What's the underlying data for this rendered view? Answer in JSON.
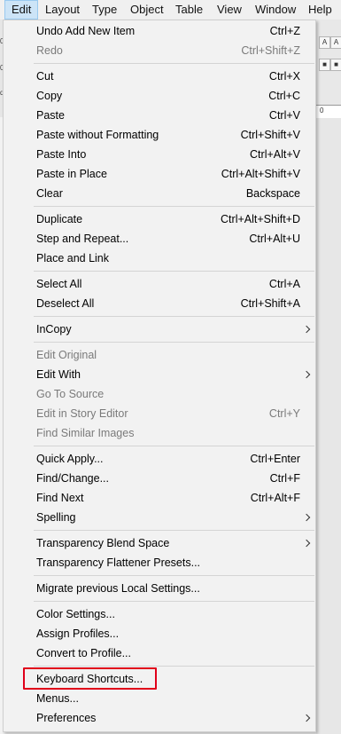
{
  "menubar": {
    "items": [
      "Edit",
      "Layout",
      "Type",
      "Object",
      "Table",
      "View",
      "Window",
      "Help"
    ],
    "active": "Edit"
  },
  "background": {
    "left_fragments": [
      "02",
      "0",
      "d"
    ],
    "ruler_label": "0",
    "controls": [
      "A",
      "A",
      "■",
      "■"
    ]
  },
  "menu": {
    "items": [
      {
        "label": "Undo Add New Item",
        "shortcut": "Ctrl+Z",
        "enabled": true
      },
      {
        "label": "Redo",
        "shortcut": "Ctrl+Shift+Z",
        "enabled": false
      },
      {
        "label": "Cut",
        "shortcut": "Ctrl+X",
        "enabled": true
      },
      {
        "label": "Copy",
        "shortcut": "Ctrl+C",
        "enabled": true
      },
      {
        "label": "Paste",
        "shortcut": "Ctrl+V",
        "enabled": true
      },
      {
        "label": "Paste without Formatting",
        "shortcut": "Ctrl+Shift+V",
        "enabled": true
      },
      {
        "label": "Paste Into",
        "shortcut": "Ctrl+Alt+V",
        "enabled": true
      },
      {
        "label": "Paste in Place",
        "shortcut": "Ctrl+Alt+Shift+V",
        "enabled": true
      },
      {
        "label": "Clear",
        "shortcut": "Backspace",
        "enabled": true
      },
      {
        "label": "Duplicate",
        "shortcut": "Ctrl+Alt+Shift+D",
        "enabled": true
      },
      {
        "label": "Step and Repeat...",
        "shortcut": "Ctrl+Alt+U",
        "enabled": true
      },
      {
        "label": "Place and Link",
        "shortcut": "",
        "enabled": true
      },
      {
        "label": "Select All",
        "shortcut": "Ctrl+A",
        "enabled": true
      },
      {
        "label": "Deselect All",
        "shortcut": "Ctrl+Shift+A",
        "enabled": true
      },
      {
        "label": "InCopy",
        "shortcut": "",
        "enabled": true,
        "submenu": true
      },
      {
        "label": "Edit Original",
        "shortcut": "",
        "enabled": false
      },
      {
        "label": "Edit With",
        "shortcut": "",
        "enabled": true,
        "submenu": true
      },
      {
        "label": "Go To Source",
        "shortcut": "",
        "enabled": false
      },
      {
        "label": "Edit in Story Editor",
        "shortcut": "Ctrl+Y",
        "enabled": false
      },
      {
        "label": "Find Similar Images",
        "shortcut": "",
        "enabled": false
      },
      {
        "label": "Quick Apply...",
        "shortcut": "Ctrl+Enter",
        "enabled": true
      },
      {
        "label": "Find/Change...",
        "shortcut": "Ctrl+F",
        "enabled": true
      },
      {
        "label": "Find Next",
        "shortcut": "Ctrl+Alt+F",
        "enabled": true
      },
      {
        "label": "Spelling",
        "shortcut": "",
        "enabled": true,
        "submenu": true
      },
      {
        "label": "Transparency Blend Space",
        "shortcut": "",
        "enabled": true,
        "submenu": true
      },
      {
        "label": "Transparency Flattener Presets...",
        "shortcut": "",
        "enabled": true
      },
      {
        "label": "Migrate previous Local Settings...",
        "shortcut": "",
        "enabled": true
      },
      {
        "label": "Color Settings...",
        "shortcut": "",
        "enabled": true
      },
      {
        "label": "Assign Profiles...",
        "shortcut": "",
        "enabled": true
      },
      {
        "label": "Convert to Profile...",
        "shortcut": "",
        "enabled": true
      },
      {
        "label": "Keyboard Shortcuts...",
        "shortcut": "",
        "enabled": true,
        "highlighted": true
      },
      {
        "label": "Menus...",
        "shortcut": "",
        "enabled": true
      },
      {
        "label": "Preferences",
        "shortcut": "",
        "enabled": true,
        "submenu": true
      }
    ]
  },
  "colors": {
    "highlight_outline": "#e0001a",
    "active_menu_bg": "#cce4f7",
    "disabled_text": "#7a7a7a"
  }
}
